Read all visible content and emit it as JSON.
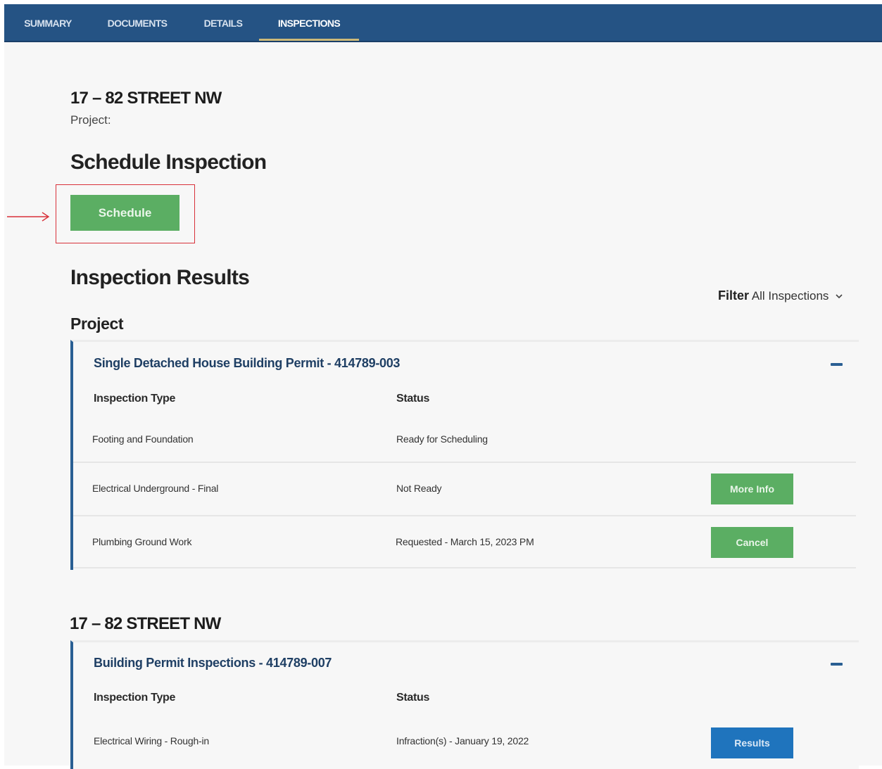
{
  "tabs": [
    {
      "label": "SUMMARY",
      "active": false
    },
    {
      "label": "DOCUMENTS",
      "active": false
    },
    {
      "label": "DETAILS",
      "active": false
    },
    {
      "label": "INSPECTIONS",
      "active": true
    }
  ],
  "header": {
    "address": "17 – 82 STREET NW",
    "project_label": "Project:"
  },
  "schedule_section": {
    "title": "Schedule Inspection",
    "button_label": "Schedule"
  },
  "results": {
    "title": "Inspection Results",
    "filter_label": "Filter",
    "filter_value": "All Inspections",
    "group_title": "Project"
  },
  "permit_cards": [
    {
      "title": "Single Detached House Building Permit - 414789-003",
      "col_type": "Inspection Type",
      "col_status": "Status",
      "rows": [
        {
          "type": "Footing and Foundation",
          "status": "Ready for Scheduling",
          "action": ""
        },
        {
          "type": "Electrical Underground - Final",
          "status": "Not Ready",
          "action": "More Info"
        },
        {
          "type": "Plumbing Ground Work",
          "status": "Requested - March 15, 2023 PM",
          "action": "Cancel"
        }
      ]
    },
    {
      "address": "17 – 82 STREET NW",
      "title": "Building Permit Inspections - 414789-007",
      "col_type": "Inspection Type",
      "col_status": "Status",
      "rows": [
        {
          "type": "Electrical Wiring - Rough-in",
          "status": "Infraction(s) - January 19, 2022",
          "action": "Results"
        }
      ]
    }
  ],
  "colors": {
    "nav_bg": "#255384",
    "accent_green": "#5bae63",
    "accent_blue": "#1f74bd",
    "card_border": "#2a5f93",
    "annotation_red": "#d8313a"
  },
  "icons": {
    "filter_chevron": "chevron-down-icon",
    "collapse": "minus-icon",
    "annotation_arrow": "arrow-right-icon"
  }
}
